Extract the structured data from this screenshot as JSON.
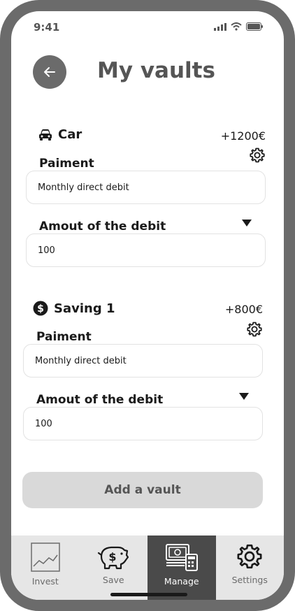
{
  "status": {
    "time": "9:41"
  },
  "header": {
    "title": "My vaults"
  },
  "vaults": [
    {
      "icon": "car-icon",
      "name": "Car",
      "amount": "+1200€",
      "payment_label": "Paiment",
      "payment_value": "Monthly direct debit",
      "debit_label": "Amout of the debit",
      "debit_value": "100"
    },
    {
      "icon": "dollar-coin-icon",
      "name": "Saving 1",
      "amount": "+800€",
      "payment_label": "Paiment",
      "payment_value": "Monthly direct debit",
      "debit_label": "Amout of the debit",
      "debit_value": "100"
    }
  ],
  "actions": {
    "add_vault": "Add a vault"
  },
  "tabbar": {
    "items": [
      {
        "label": "Invest",
        "icon": "chart-icon",
        "active": false
      },
      {
        "label": "Save",
        "icon": "piggy-bank-icon",
        "active": false
      },
      {
        "label": "Manage",
        "icon": "money-calculator-icon",
        "active": true
      },
      {
        "label": "Settings",
        "icon": "gear-icon",
        "active": false
      }
    ]
  },
  "colors": {
    "frame": "#6b6b6b",
    "tabbar": "#e6e6e6",
    "active_tab": "#4a4a4a",
    "button": "#d9d9d9"
  }
}
